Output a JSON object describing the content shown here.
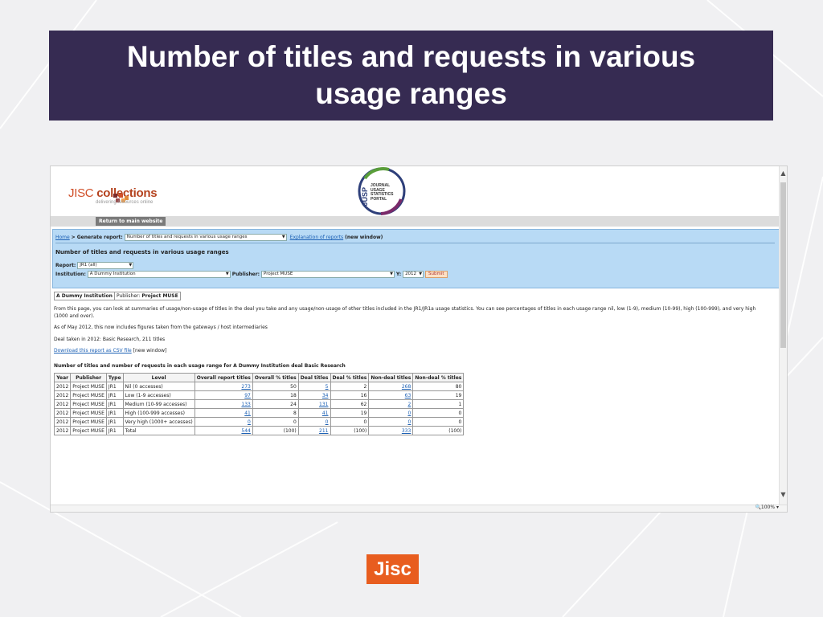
{
  "slide": {
    "title_line1": "Number of titles and requests in various",
    "title_line2": "usage ranges",
    "banner_color": "#362b52",
    "footer_logo": "Jisc"
  },
  "site": {
    "logo_text_a": "JISC",
    "logo_text_b": "collections",
    "logo_tagline": "delivering resources online",
    "jusp_mark": "JUSP",
    "jusp_words": [
      "JOURNAL",
      "USAGE",
      "STATISTICS",
      "PORTAL"
    ],
    "return_button": "Return to main website"
  },
  "panel": {
    "home_link": "Home",
    "generate_label": "> Generate report:",
    "report_select": "Number of titles and requests in various usage ranges",
    "explanation_link": "Explanation of reports",
    "new_window": "(new window)",
    "heading": "Number of titles and requests in various usage ranges",
    "report_label": "Report:",
    "report_value": "JR1 (all)",
    "institution_label": "Institution:",
    "institution_value": "A Dummy Institution",
    "publisher_label": "Publisher:",
    "publisher_value": "Project MUSE",
    "y_label": "Y:",
    "y_value": "2012",
    "submit": "Submit"
  },
  "tabs": {
    "institution": "A Dummy Institution",
    "publisher": "Publisher: Project MUSE"
  },
  "content": {
    "intro": "From this page, you can look at summaries of usage/non-usage of titles in the deal you take and any usage/non-usage of other titles included in the JR1/JR1a usage statistics. You can see percentages of titles in each usage range nil, low (1-9), medium (10-99), high (100-999), and very high (1000 and over).",
    "note": "As of May 2012, this now includes figures taken from the gateways / host intermediaries",
    "deal": "Deal taken in 2012: Basic Research, 211 titles",
    "csv_link": "Download this report as CSV file",
    "csv_suffix": "[new window]",
    "table_title": "Number of titles and number of requests in each usage range for A Dummy Institution deal Basic Research"
  },
  "table": {
    "headers": [
      "Year",
      "Publisher",
      "Type",
      "Level",
      "Overall report titles",
      "Overall % titles",
      "Deal titles",
      "Deal % titles",
      "Non-deal titles",
      "Non-deal % titles"
    ],
    "rows": [
      [
        "2012",
        "Project MUSE",
        "JR1",
        "Nil (0 accesses)",
        "273",
        "50",
        "5",
        "2",
        "268",
        "80"
      ],
      [
        "2012",
        "Project MUSE",
        "JR1",
        "Low (1-9 accesses)",
        "97",
        "18",
        "34",
        "16",
        "63",
        "19"
      ],
      [
        "2012",
        "Project MUSE",
        "JR1",
        "Medium (10-99 accesses)",
        "133",
        "24",
        "131",
        "62",
        "2",
        "1"
      ],
      [
        "2012",
        "Project MUSE",
        "JR1",
        "High (100-999 accesses)",
        "41",
        "8",
        "41",
        "19",
        "0",
        "0"
      ],
      [
        "2012",
        "Project MUSE",
        "JR1",
        "Very high (1000+ accesses)",
        "0",
        "0",
        "0",
        "0",
        "0",
        "0"
      ],
      [
        "2012",
        "Project MUSE",
        "JR1",
        "Total",
        "544",
        "(100)",
        "211",
        "(100)",
        "333",
        "(100)"
      ]
    ]
  },
  "browser": {
    "zoom": "100%"
  }
}
